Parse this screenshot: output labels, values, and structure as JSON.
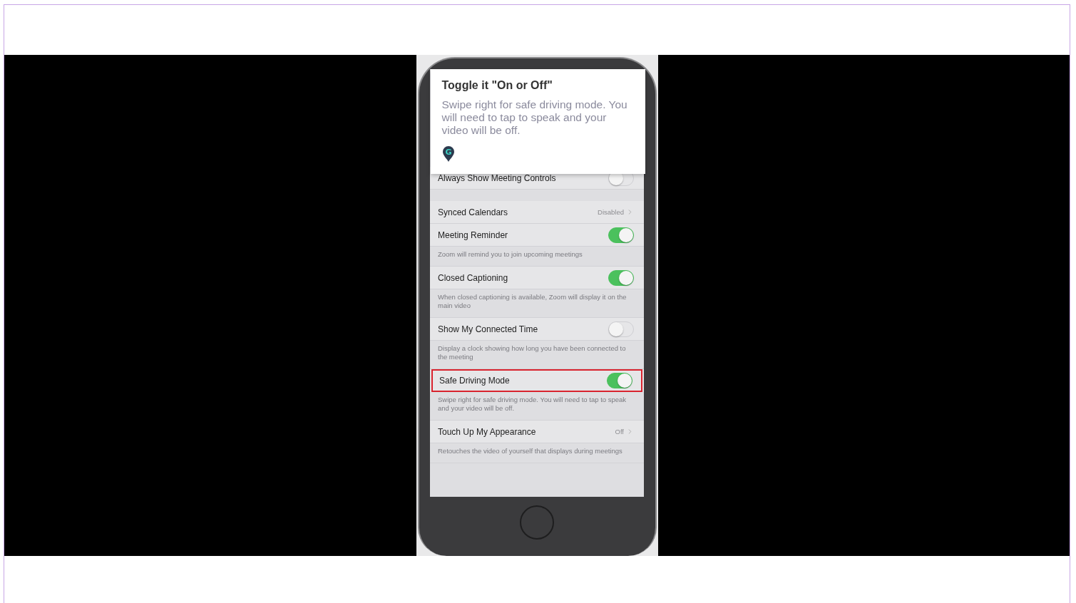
{
  "tooltip": {
    "title": "Toggle it \"On or Off\"",
    "body": "Swipe right for safe driving mode. You will need to tap to speak and your video will be off.",
    "logo_letter": "G"
  },
  "groups": [
    {
      "rows": [
        {
          "kind": "toggle",
          "label": "Always Show Meeting Controls",
          "on": false,
          "highlighted": false
        }
      ]
    },
    {
      "rows": [
        {
          "kind": "link",
          "label": "Synced Calendars",
          "value": "Disabled",
          "highlighted": false
        },
        {
          "kind": "toggle",
          "label": "Meeting Reminder",
          "on": true,
          "highlighted": false,
          "description": "Zoom will remind you to join upcoming meetings"
        },
        {
          "kind": "toggle",
          "label": "Closed Captioning",
          "on": true,
          "highlighted": false,
          "description": "When closed captioning is available, Zoom will display it on the main video"
        },
        {
          "kind": "toggle",
          "label": "Show My Connected Time",
          "on": false,
          "highlighted": false,
          "description": "Display a clock showing how long you have been connected to the meeting"
        },
        {
          "kind": "toggle",
          "label": "Safe Driving Mode",
          "on": true,
          "highlighted": true,
          "description": "Swipe right for safe driving mode. You will need to tap to speak and your video will be off."
        },
        {
          "kind": "link",
          "label": "Touch Up My Appearance",
          "value": "Off",
          "highlighted": false,
          "description": "Retouches the video of yourself that displays during meetings"
        }
      ]
    }
  ]
}
